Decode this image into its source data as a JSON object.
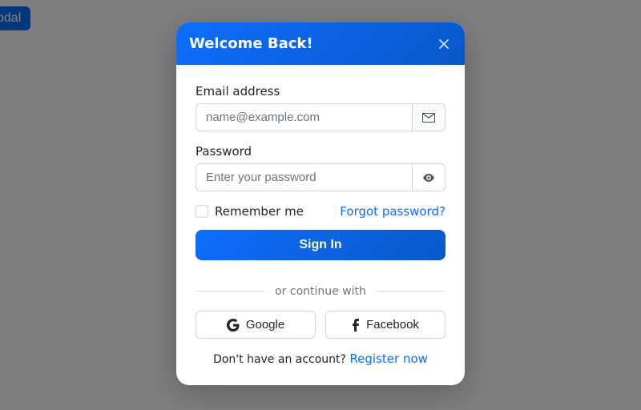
{
  "launch_label": "odal",
  "modal": {
    "title": "Welcome Back!",
    "email": {
      "label": "Email address",
      "placeholder": "name@example.com",
      "value": ""
    },
    "password": {
      "label": "Password",
      "placeholder": "Enter your password",
      "value": ""
    },
    "remember_label": "Remember me",
    "forgot_label": "Forgot password?",
    "signin_label": "Sign In",
    "divider_label": "or continue with",
    "social": {
      "google": "Google",
      "facebook": "Facebook"
    },
    "footer_prompt": "Don't have an account? ",
    "register_label": "Register now"
  }
}
